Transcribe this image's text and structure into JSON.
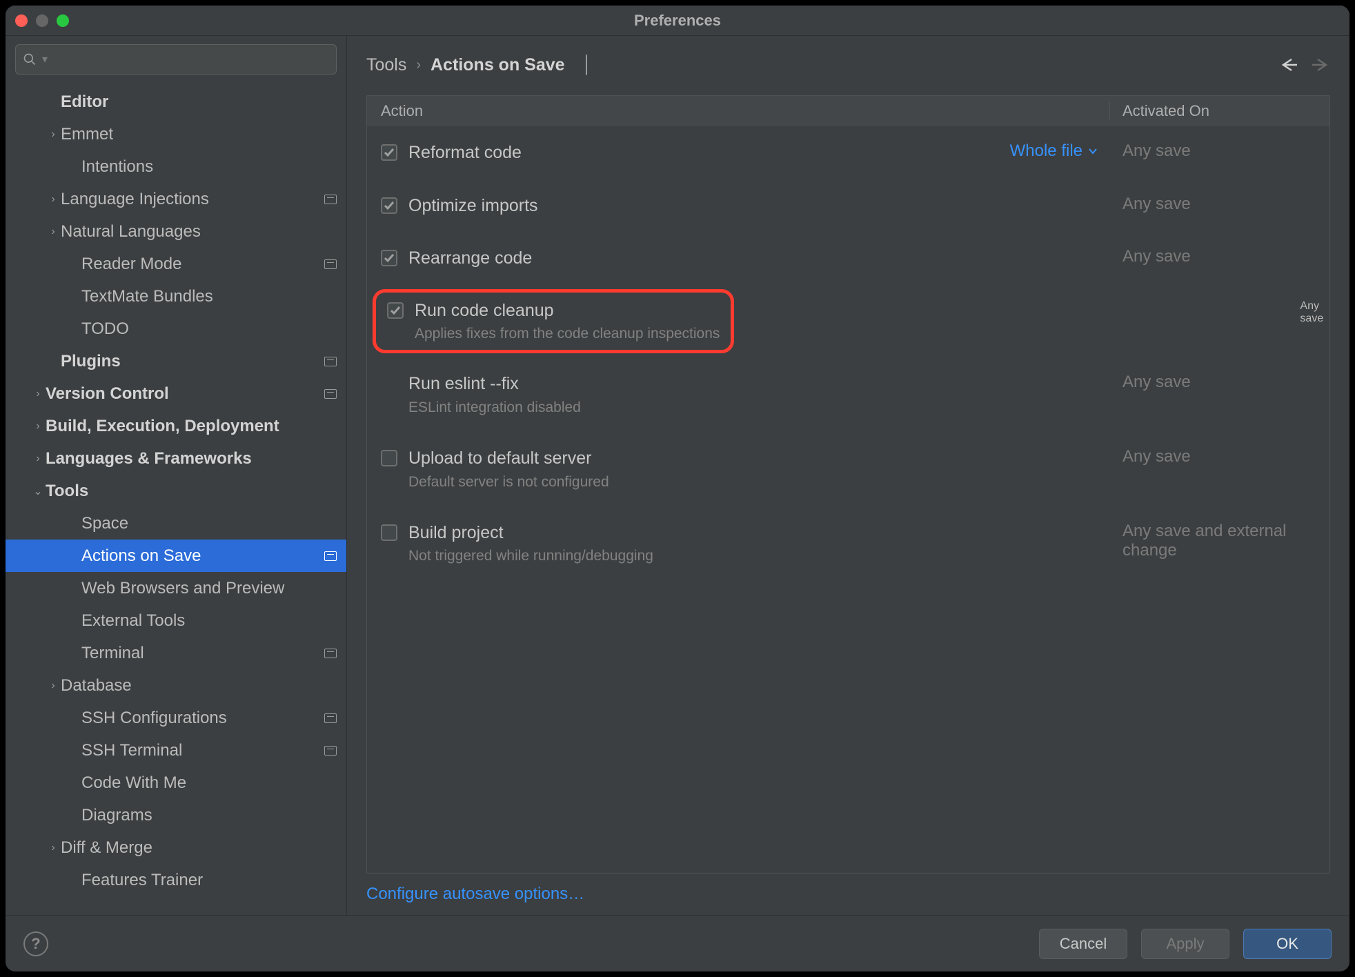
{
  "window": {
    "title": "Preferences"
  },
  "search": {
    "placeholder": ""
  },
  "sidebar": [
    {
      "label": "Editor",
      "depth": 1,
      "bold": true,
      "expandable": false,
      "expanded": false,
      "badge": false
    },
    {
      "label": "Emmet",
      "depth": 2,
      "bold": false,
      "expandable": true,
      "expanded": false,
      "badge": false
    },
    {
      "label": "Intentions",
      "depth": 2,
      "bold": false,
      "expandable": false,
      "expanded": false,
      "badge": false
    },
    {
      "label": "Language Injections",
      "depth": 2,
      "bold": false,
      "expandable": true,
      "expanded": false,
      "badge": true
    },
    {
      "label": "Natural Languages",
      "depth": 2,
      "bold": false,
      "expandable": true,
      "expanded": false,
      "badge": false
    },
    {
      "label": "Reader Mode",
      "depth": 2,
      "bold": false,
      "expandable": false,
      "expanded": false,
      "badge": true
    },
    {
      "label": "TextMate Bundles",
      "depth": 2,
      "bold": false,
      "expandable": false,
      "expanded": false,
      "badge": false
    },
    {
      "label": "TODO",
      "depth": 2,
      "bold": false,
      "expandable": false,
      "expanded": false,
      "badge": false
    },
    {
      "label": "Plugins",
      "depth": 1,
      "bold": true,
      "expandable": false,
      "expanded": false,
      "badge": true
    },
    {
      "label": "Version Control",
      "depth": 1,
      "bold": true,
      "expandable": true,
      "expanded": false,
      "badge": true
    },
    {
      "label": "Build, Execution, Deployment",
      "depth": 1,
      "bold": true,
      "expandable": true,
      "expanded": false,
      "badge": false
    },
    {
      "label": "Languages & Frameworks",
      "depth": 1,
      "bold": true,
      "expandable": true,
      "expanded": false,
      "badge": false
    },
    {
      "label": "Tools",
      "depth": 1,
      "bold": true,
      "expandable": true,
      "expanded": true,
      "badge": false
    },
    {
      "label": "Space",
      "depth": 2,
      "bold": false,
      "expandable": false,
      "expanded": false,
      "badge": false
    },
    {
      "label": "Actions on Save",
      "depth": 2,
      "bold": false,
      "expandable": false,
      "expanded": false,
      "badge": true,
      "selected": true
    },
    {
      "label": "Web Browsers and Preview",
      "depth": 2,
      "bold": false,
      "expandable": false,
      "expanded": false,
      "badge": false
    },
    {
      "label": "External Tools",
      "depth": 2,
      "bold": false,
      "expandable": false,
      "expanded": false,
      "badge": false
    },
    {
      "label": "Terminal",
      "depth": 2,
      "bold": false,
      "expandable": false,
      "expanded": false,
      "badge": true
    },
    {
      "label": "Database",
      "depth": 2,
      "bold": false,
      "expandable": true,
      "expanded": false,
      "badge": false
    },
    {
      "label": "SSH Configurations",
      "depth": 2,
      "bold": false,
      "expandable": false,
      "expanded": false,
      "badge": true
    },
    {
      "label": "SSH Terminal",
      "depth": 2,
      "bold": false,
      "expandable": false,
      "expanded": false,
      "badge": true
    },
    {
      "label": "Code With Me",
      "depth": 2,
      "bold": false,
      "expandable": false,
      "expanded": false,
      "badge": false
    },
    {
      "label": "Diagrams",
      "depth": 2,
      "bold": false,
      "expandable": false,
      "expanded": false,
      "badge": false
    },
    {
      "label": "Diff & Merge",
      "depth": 2,
      "bold": false,
      "expandable": true,
      "expanded": false,
      "badge": false
    },
    {
      "label": "Features Trainer",
      "depth": 2,
      "bold": false,
      "expandable": false,
      "expanded": false,
      "badge": false
    }
  ],
  "breadcrumb": {
    "parent": "Tools",
    "current": "Actions on Save"
  },
  "table": {
    "columns": {
      "action": "Action",
      "activated": "Activated On"
    },
    "rows": [
      {
        "checked": true,
        "label": "Reformat code",
        "sub": "",
        "scope": "Whole file",
        "activated": "Any save",
        "highlight": false,
        "has_checkbox": true
      },
      {
        "checked": true,
        "label": "Optimize imports",
        "sub": "",
        "scope": "",
        "activated": "Any save",
        "highlight": false,
        "has_checkbox": true
      },
      {
        "checked": true,
        "label": "Rearrange code",
        "sub": "",
        "scope": "",
        "activated": "Any save",
        "highlight": false,
        "has_checkbox": true
      },
      {
        "checked": true,
        "label": "Run code cleanup",
        "sub": "Applies fixes from the code cleanup inspections",
        "scope": "",
        "activated": "Any save",
        "highlight": true,
        "has_checkbox": true
      },
      {
        "checked": false,
        "label": "Run eslint --fix",
        "sub": "ESLint integration disabled",
        "scope": "",
        "activated": "Any save",
        "highlight": false,
        "has_checkbox": false
      },
      {
        "checked": false,
        "label": "Upload to default server",
        "sub": "Default server is not configured",
        "scope": "",
        "activated": "Any save",
        "highlight": false,
        "has_checkbox": true
      },
      {
        "checked": false,
        "label": "Build project",
        "sub": "Not triggered while running/debugging",
        "scope": "",
        "activated": "Any save and external change",
        "highlight": false,
        "has_checkbox": true
      }
    ]
  },
  "configure_link": "Configure autosave options…",
  "buttons": {
    "cancel": "Cancel",
    "apply": "Apply",
    "ok": "OK"
  }
}
